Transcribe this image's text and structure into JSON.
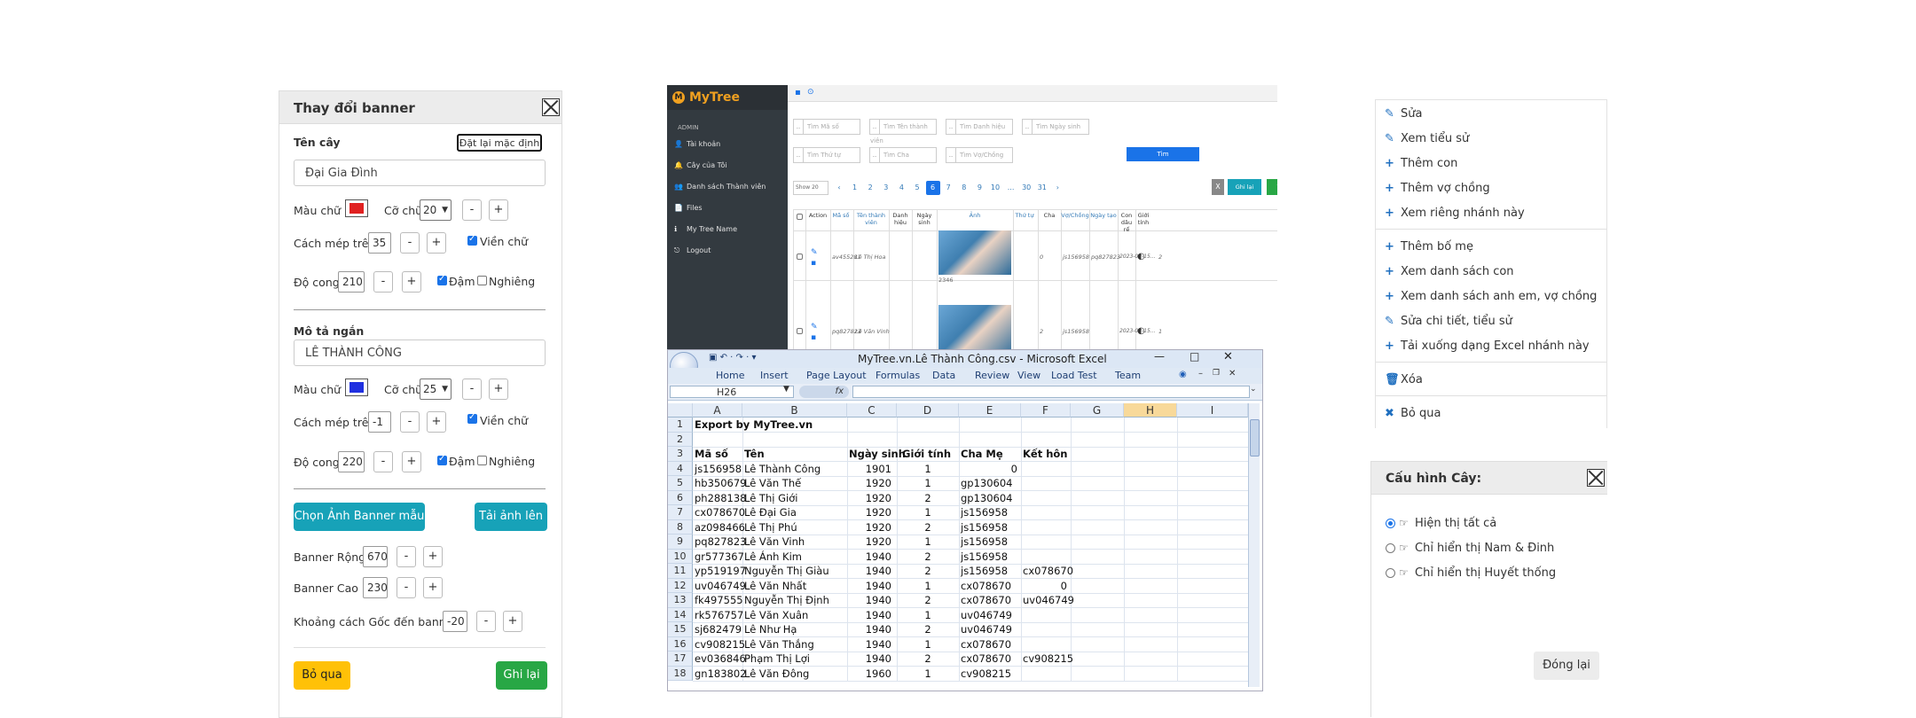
{
  "banner_dialog": {
    "title": "Thay đổi banner",
    "ten_cay_label": "Tên cây",
    "reset_label": "Đặt lại mặc định",
    "ten_cay_value": "Đại Gia Đình",
    "mau_chu": "Màu chữ",
    "co_chu": "Cỡ chữ",
    "cach_mep_tren": "Cách mép trên",
    "vien_chu": "Viền chữ",
    "do_cong": "Độ cong",
    "dam": "Đậm",
    "nghieng": "Nghiêng",
    "minus": "-",
    "plus": "+",
    "title_section": {
      "color": "#e02020",
      "size": "20",
      "top": "35",
      "radius": "210"
    },
    "mo_ta_label": "Mô tả ngắn",
    "mo_ta_value": "LÊ THÀNH CÔNG",
    "desc_section": {
      "color": "#2030e0",
      "size": "25",
      "top": "-1",
      "radius": "220"
    },
    "chon_anh": "Chọn Ảnh Banner mẫu",
    "tai_anh": "Tải ảnh lên",
    "banner_rong_label": "Banner Rộng:",
    "banner_rong": "670",
    "banner_cao_label": "Banner Cao",
    "banner_cao": "230",
    "khoang_cach_label": "Khoảng cách Gốc đến banner",
    "khoang_cach": "-20",
    "bo_qua": "Bỏ qua",
    "ghi_lai": "Ghi lại"
  },
  "app": {
    "logo": "MyTree",
    "admin": "ADMIN",
    "sidebar": [
      {
        "icon": "user-icon",
        "glyph": "👤",
        "label": "Tài khoản"
      },
      {
        "icon": "bell-icon",
        "glyph": "🔔",
        "label": "Cây của Tôi"
      },
      {
        "icon": "users-icon",
        "glyph": "👥",
        "label": "Danh sách Thành viên"
      },
      {
        "icon": "file-icon",
        "glyph": "📄",
        "label": "Files"
      },
      {
        "icon": "info-icon",
        "glyph": "ℹ",
        "label": "My Tree Name"
      },
      {
        "icon": "logout-icon",
        "glyph": "⎋",
        "label": "Logout"
      }
    ],
    "filters": [
      "Tìm Mã số",
      "Tìm Tên thành viên",
      "Tìm Danh hiệu",
      "Tìm Ngày sinh",
      "Tìm Thứ tự",
      "Tìm Cha",
      "Tìm Vợ/Chồng"
    ],
    "search_btn": "Tìm",
    "show": "Show 20",
    "pages": [
      "‹",
      "1",
      "2",
      "3",
      "4",
      "5",
      "6",
      "7",
      "8",
      "9",
      "10",
      "...",
      "30",
      "31",
      "›"
    ],
    "active_page": "6",
    "ghi_lai": "Ghi lại",
    "them_moi": "Thêm mới",
    "columns": [
      "Action",
      "Mã số",
      "Tên thành viên",
      "Danh hiệu",
      "Ngày sinh",
      "Ảnh",
      "Thứ tự",
      "Cha",
      "Vợ/Chồng",
      "Ngày tạo",
      "Con dâu rể",
      "Giới tính"
    ],
    "rows": [
      {
        "id": "av455281",
        "name": "Lê Thị Hoa",
        "order": "0",
        "father": "js156958",
        "spouse": "pq827823",
        "created": "2023-02-15...",
        "gender": "2",
        "caption": "2346"
      },
      {
        "id": "pq827823",
        "name": "Lê Văn Vinh",
        "order": "2",
        "father": "js156958",
        "spouse": "",
        "created": "2023-02-15...",
        "gender": "1",
        "caption": ""
      }
    ]
  },
  "excel": {
    "title": "MyTree.vn.Lê Thành Công.csv - Microsoft Excel",
    "tabs": [
      "Home",
      "Insert",
      "Page Layout",
      "Formulas",
      "Data",
      "Review",
      "View",
      "Load Test",
      "Team"
    ],
    "name_box": "H26",
    "fx": "fx",
    "columns": [
      "A",
      "B",
      "C",
      "D",
      "E",
      "F",
      "G",
      "H",
      "I"
    ],
    "rows": [
      {
        "n": "1",
        "a": "Export by MyTree.vn",
        "b": "",
        "c": "",
        "d": "",
        "e": "",
        "f": ""
      },
      {
        "n": "2",
        "a": "",
        "b": "",
        "c": "",
        "d": "",
        "e": "",
        "f": ""
      },
      {
        "n": "3",
        "a": "Mã số",
        "b": "Tên",
        "c": "Ngày sinh",
        "d": "Giới tính",
        "e": "Cha Mẹ",
        "f": "Kết hôn"
      },
      {
        "n": "4",
        "a": "js156958",
        "b": "Lê Thành Công",
        "c": "1901",
        "d": "1",
        "e": "0",
        "f": ""
      },
      {
        "n": "5",
        "a": "hb350679",
        "b": "Lê Văn Thế",
        "c": "1920",
        "d": "1",
        "e": "gp130604",
        "f": ""
      },
      {
        "n": "6",
        "a": "ph288138",
        "b": "Lê Thị Giới",
        "c": "1920",
        "d": "2",
        "e": "gp130604",
        "f": ""
      },
      {
        "n": "7",
        "a": "cx078670",
        "b": "Lê Đại Gia",
        "c": "1920",
        "d": "1",
        "e": "js156958",
        "f": ""
      },
      {
        "n": "8",
        "a": "az098466",
        "b": "Lê Thị Phú",
        "c": "1920",
        "d": "2",
        "e": "js156958",
        "f": ""
      },
      {
        "n": "9",
        "a": "pq827823",
        "b": "Lê Văn Vinh",
        "c": "1920",
        "d": "1",
        "e": "js156958",
        "f": ""
      },
      {
        "n": "10",
        "a": "gr577367",
        "b": "Lê Ánh Kim",
        "c": "1940",
        "d": "2",
        "e": "js156958",
        "f": ""
      },
      {
        "n": "11",
        "a": "yp519197",
        "b": "Nguyễn Thị Giàu",
        "c": "1940",
        "d": "2",
        "e": "js156958",
        "f": "cx078670"
      },
      {
        "n": "12",
        "a": "uv046749",
        "b": "Lê Văn Nhất",
        "c": "1940",
        "d": "1",
        "e": "cx078670",
        "f": "0"
      },
      {
        "n": "13",
        "a": "fk497555",
        "b": "Nguyễn Thị Định",
        "c": "1940",
        "d": "2",
        "e": "cx078670",
        "f": "uv046749"
      },
      {
        "n": "14",
        "a": "rk576757",
        "b": "Lê Văn Xuân",
        "c": "1940",
        "d": "1",
        "e": "uv046749",
        "f": ""
      },
      {
        "n": "15",
        "a": "sj682479",
        "b": "Lê Như Hạ",
        "c": "1940",
        "d": "2",
        "e": "uv046749",
        "f": ""
      },
      {
        "n": "16",
        "a": "cv908215",
        "b": "Lê Văn Thắng",
        "c": "1940",
        "d": "1",
        "e": "cx078670",
        "f": ""
      },
      {
        "n": "17",
        "a": "ev036846",
        "b": "Phạm Thị Lợi",
        "c": "1940",
        "d": "2",
        "e": "cx078670",
        "f": "cv908215"
      },
      {
        "n": "18",
        "a": "gn183802",
        "b": "Lê Văn Đông",
        "c": "1960",
        "d": "1",
        "e": "cv908215",
        "f": ""
      }
    ]
  },
  "context_menu": {
    "items": [
      {
        "icon": "edit-icon",
        "glyph": "✎",
        "label": "Sửa"
      },
      {
        "icon": "edit-icon",
        "glyph": "✎",
        "label": "Xem tiểu sử"
      },
      {
        "icon": "plus-icon",
        "glyph": "+",
        "label": "Thêm con"
      },
      {
        "icon": "plus-icon",
        "glyph": "+",
        "label": "Thêm vợ chồng"
      },
      {
        "icon": "plus-icon",
        "glyph": "+",
        "label": "Xem riêng nhánh này"
      },
      {
        "icon": "plus-icon",
        "glyph": "+",
        "label": "Thêm bố mẹ"
      },
      {
        "icon": "plus-icon",
        "glyph": "+",
        "label": "Xem danh sách con"
      },
      {
        "icon": "plus-icon",
        "glyph": "+",
        "label": "Xem danh sách anh em, vợ chồng"
      },
      {
        "icon": "edit-icon",
        "glyph": "✎",
        "label": "Sửa chi tiết, tiểu sử"
      },
      {
        "icon": "plus-icon",
        "glyph": "+",
        "label": "Tải xuống dạng Excel nhánh này"
      },
      {
        "icon": "trash-icon",
        "glyph": "🗑",
        "label": "Xóa"
      },
      {
        "icon": "close-icon",
        "glyph": "✖",
        "label": "Bỏ qua"
      }
    ]
  },
  "config_dialog": {
    "title": "Cấu hình Cây:",
    "options": [
      "Hiện thị tất cả",
      "Chỉ hiển thị Nam & Đinh",
      "Chỉ hiển thị Huyết thống"
    ],
    "selected": 0,
    "close": "Đóng lại"
  },
  "colors": {
    "primary": "#17a2b8",
    "success": "#28a745",
    "warning": "#ffc107",
    "blue": "#1a73e8"
  }
}
